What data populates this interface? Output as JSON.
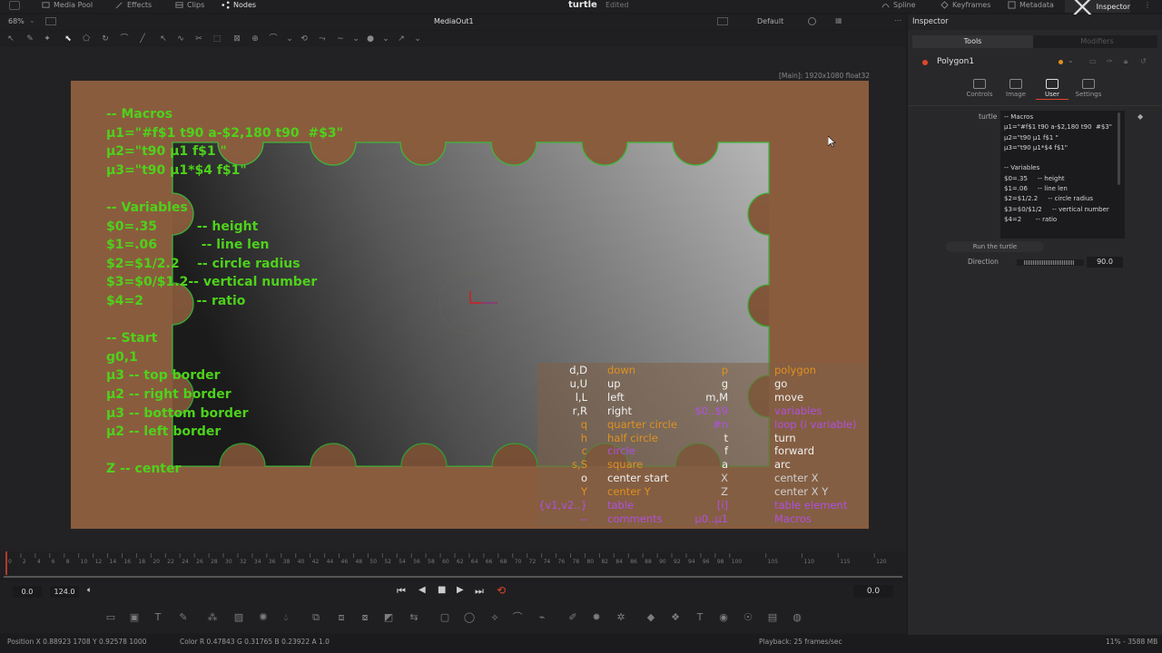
{
  "topbar": {
    "media_pool": "Media Pool",
    "effects": "Effects",
    "clips": "Clips",
    "nodes": "Nodes",
    "project": "turtle",
    "status": "Edited",
    "spline": "Spline",
    "keyframes": "Keyframes",
    "metadata": "Metadata",
    "inspector": "Inspector"
  },
  "viewer": {
    "zoom": "68%",
    "output_name": "MediaOut1",
    "view_mode": "Default",
    "resolution_info": "[Main]: 1920x1080 float32"
  },
  "canvas_text": {
    "left_block": "-- Macros\nμ1=\"#f$1 t90 a-$2,180 t90  #$3\"\nμ2=\"t90 μ1 f$1 \"\nμ3=\"t90 μ1*$4 f$1\"\n\n-- Variables\n$0=.35         -- height\n$1=.06          -- line len\n$2=$1/2.2    -- circle radius\n$3=$0/$1.2-- vertical number\n$4=2            -- ratio\n\n-- Start\ng0,1\nμ3 -- top border\nμ2 -- right border\nμ3 -- bottom border\nμ2 -- left border\n\nZ -- center"
  },
  "legend": {
    "rows": [
      {
        "k1": "d,D",
        "v1": "down",
        "k2": "p",
        "v2": "polygon",
        "c2": "#e09020"
      },
      {
        "k1": "u,U",
        "v1": "up",
        "k2": "g",
        "v2": "go",
        "c2": "#f0f0f0"
      },
      {
        "k1": "l,L",
        "v1": "left",
        "k2": "m,M",
        "v2": "move",
        "c2": "#f0f0f0"
      },
      {
        "k1": "r,R",
        "v1": "right",
        "k2": "$0..$9",
        "v2": "variables",
        "c2": "#b050e0"
      },
      {
        "k1": "q",
        "v1": "quarter circle",
        "k2": "#n",
        "v2": "loop (i variable)",
        "c2": "#b050e0"
      },
      {
        "k1": "h",
        "v1": "half circle",
        "k2": "t",
        "v2": "turn",
        "c2": "#f0f0f0"
      },
      {
        "k1": "c",
        "v1": "circle",
        "k2": "f",
        "v2": "forward",
        "c2": "#f0f0f0"
      },
      {
        "k1": "s,S",
        "v1": "square",
        "k2": "a",
        "v2": "arc",
        "c2": "#f0f0f0"
      },
      {
        "k1": "o",
        "v1": "center start",
        "k2": "X",
        "v2": "center X",
        "c2": "#d0d0d0"
      },
      {
        "k1": "Y",
        "v1": "center Y",
        "k2": "Z",
        "v2": "center X Y",
        "c2": "#d0d0d0"
      },
      {
        "k1": "{v1,v2..}",
        "v1": "table",
        "k2": "[i]",
        "v2": "table element",
        "c2": "#b050e0"
      },
      {
        "k1": "--",
        "v1": "comments",
        "k2": "μ0..μ1",
        "v2": "Macros",
        "c2": "#b050e0"
      }
    ],
    "k1_colors": [
      "#f0f0f0",
      "#f0f0f0",
      "#f0f0f0",
      "#f0f0f0",
      "#e09020",
      "#e09020",
      "#e09020",
      "#e09020",
      "#f0f0f0",
      "#e09020",
      "#b050e0",
      "#b050e0"
    ],
    "v1_colors": [
      "#e09020",
      "#f0f0f0",
      "#f0f0f0",
      "#f0f0f0",
      "#e09020",
      "#e09020",
      "#b050e0",
      "#e09020",
      "#f0f0f0",
      "#e09020",
      "#b050e0",
      "#b050e0"
    ]
  },
  "timeline": {
    "ticks": [
      "0",
      "2",
      "4",
      "6",
      "8",
      "10",
      "12",
      "14",
      "16",
      "18",
      "20",
      "22",
      "24",
      "26",
      "28",
      "30",
      "32",
      "34",
      "36",
      "38",
      "40",
      "42",
      "44",
      "46",
      "48",
      "50",
      "52",
      "54",
      "56",
      "58",
      "60",
      "62",
      "64",
      "66",
      "68",
      "70",
      "72",
      "74",
      "76",
      "78",
      "80",
      "82",
      "84",
      "86",
      "88",
      "90",
      "92",
      "94",
      "96",
      "98",
      "100",
      "105",
      "110",
      "115",
      "120"
    ]
  },
  "transport": {
    "start": "0.0",
    "end": "124.0",
    "current": "0.0"
  },
  "status": {
    "position": "Position  X 0.88923   1708   Y 0.92578   1000",
    "color": "Color R 0.47843   G 0.31765   B 0.23922   A 1.0",
    "playback": "Playback: 25 frames/sec",
    "memory": "11% - 3588 MB"
  },
  "inspector": {
    "title": "Inspector",
    "tab_tools": "Tools",
    "tab_modifiers": "Modifiers",
    "node_name": "Polygon1",
    "subtabs": [
      "Controls",
      "Image",
      "User",
      "Settings"
    ],
    "field_label": "turtle",
    "code": "-- Macros\nμ1=\"#f$1 t90 a-$2,180 t90  #$3\"\nμ2=\"t90 μ1 f$1 \"\nμ3=\"t90 μ1*$4 f$1\"\n\n-- Variables\n$0=.35     -- height\n$1=.06     -- line len\n$2=$1/2.2     -- circle radius\n$3=$0/$1/2     -- vertical number\n$4=2       -- ratio",
    "run_button": "Run the turtle",
    "direction_label": "Direction",
    "direction_value": "90.0"
  },
  "colors": {
    "canvas_bg": "#8a5c3e",
    "code_green": "#4ed11b",
    "accent_red": "#e0452a",
    "accent_orange": "#e09020"
  }
}
